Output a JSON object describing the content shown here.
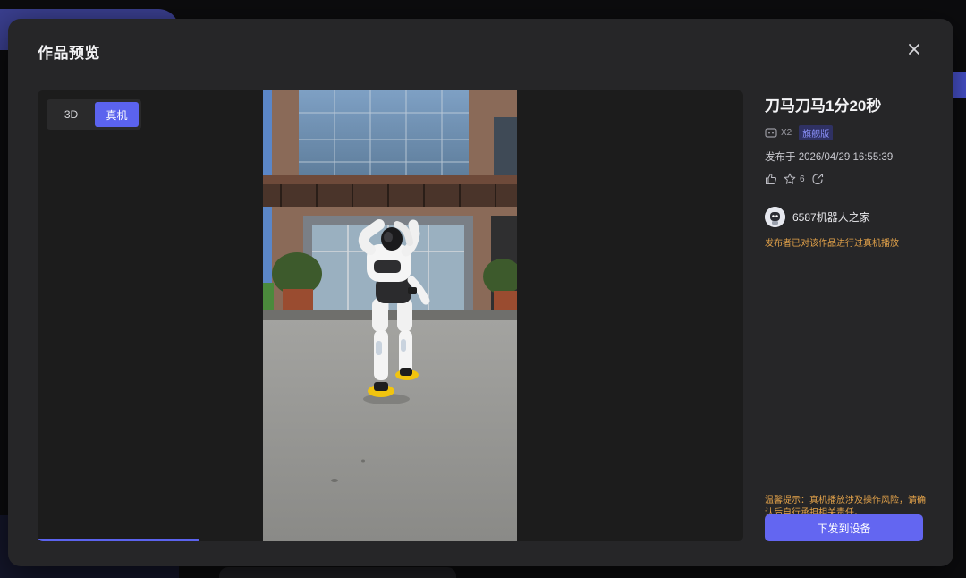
{
  "modal": {
    "title": "作品预览"
  },
  "preview": {
    "mode_options": [
      "3D",
      "真机"
    ],
    "active_mode": "真机",
    "playback_progress_percent": 23
  },
  "work": {
    "title": "刀马刀马1分20秒",
    "device": "X2",
    "device_icon": "robot-device-icon",
    "edition": "旗舰版",
    "publish_time": "发布于 2026/04/29 16:55:39",
    "favorite_count": "6",
    "author_name": "6587机器人之家",
    "played_note": "发布者已对该作品进行过真机播放",
    "warning": "温馨提示：真机播放涉及操作风险，请确认后自行承担相关责任。",
    "send_button_label": "下发到设备"
  },
  "colors": {
    "accent": "#6366f1",
    "warning": "#e4a34a",
    "modal_bg": "#262628"
  }
}
